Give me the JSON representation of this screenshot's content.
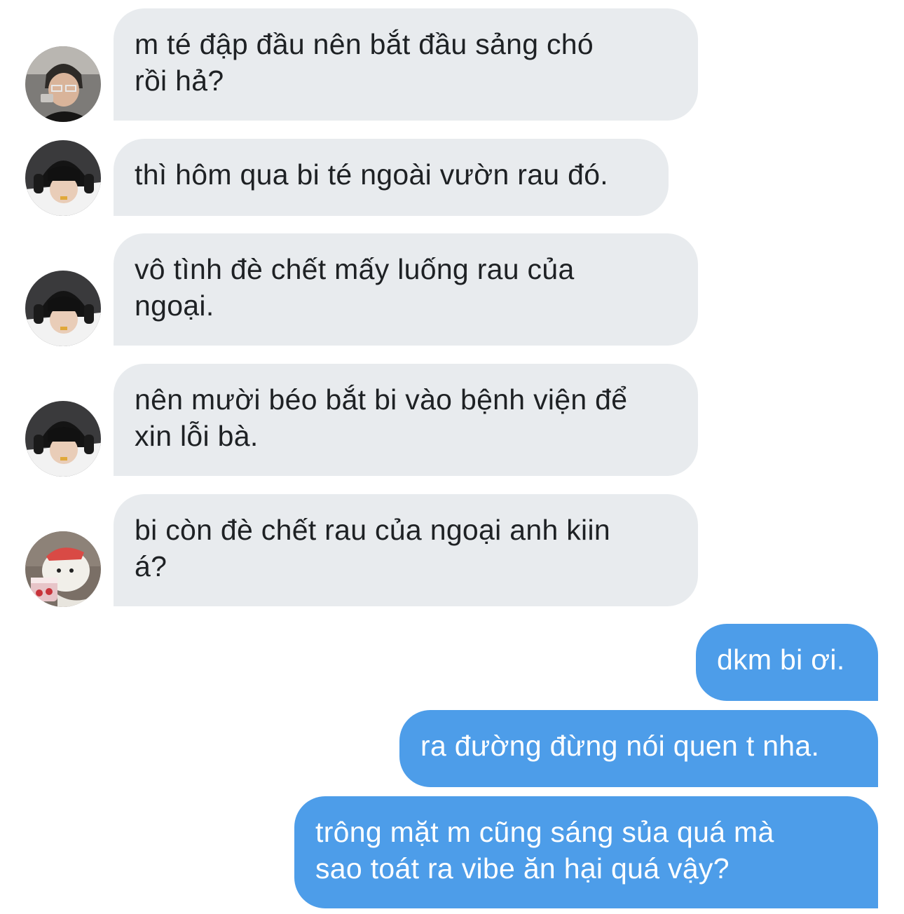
{
  "colors": {
    "incoming_bubble": "#e8ebee",
    "outgoing_bubble": "#4d9de9",
    "incoming_text": "#1e2124",
    "outgoing_text": "#ffffff"
  },
  "messages": [
    {
      "direction": "incoming",
      "avatar": "photo-avatar-glasses",
      "text": "m té đập đầu nên bắt đầu sảng chó\nrồi hả?"
    },
    {
      "direction": "incoming",
      "avatar": "photo-avatar-headphones",
      "text": "thì hôm qua bi té ngoài vườn rau đó."
    },
    {
      "direction": "incoming",
      "avatar": "photo-avatar-headphones",
      "text": "vô tình đè chết mấy luống rau của\nngoại."
    },
    {
      "direction": "incoming",
      "avatar": "photo-avatar-headphones",
      "text": "nên mười béo bắt bi vào bệnh viện để\nxin lỗi bà."
    },
    {
      "direction": "incoming",
      "avatar": "cartoon-bear-avatar",
      "text": "bi còn đè chết rau của ngoại anh kiin\ná?"
    },
    {
      "direction": "outgoing",
      "text": "dkm bi ơi."
    },
    {
      "direction": "outgoing",
      "text": "ra đường đừng nói quen t nha."
    },
    {
      "direction": "outgoing",
      "text": "trông mặt m cũng sáng sủa quá mà\nsao toát ra vibe ăn hại quá vậy?"
    }
  ]
}
